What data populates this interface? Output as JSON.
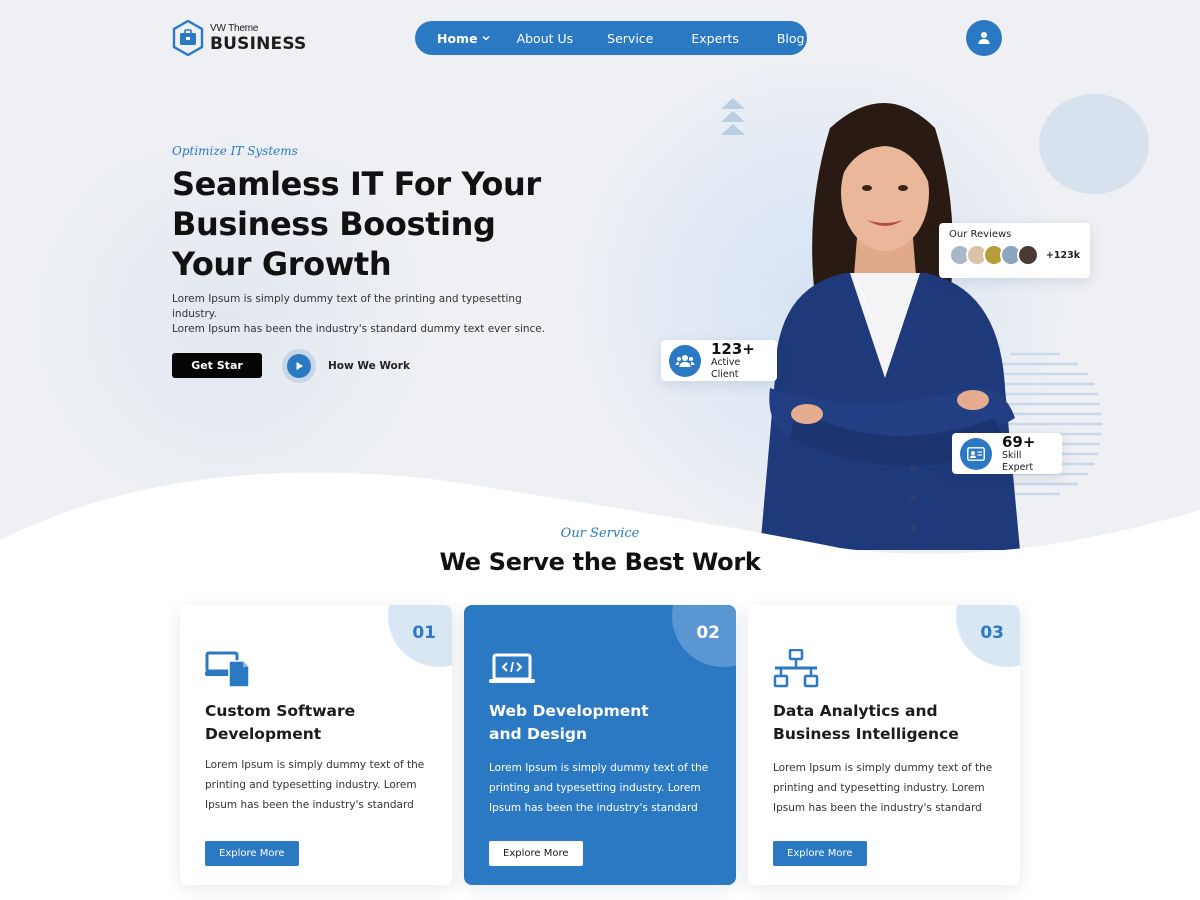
{
  "brand": {
    "small": "VW Theme",
    "big": "BUSINESS"
  },
  "nav": {
    "items": [
      {
        "label": "Home"
      },
      {
        "label": "About Us"
      },
      {
        "label": "Service"
      },
      {
        "label": "Experts"
      },
      {
        "label": "Blog"
      }
    ]
  },
  "hero": {
    "eyebrow": "Optimize IT Systems",
    "title_lines": [
      "Seamless IT For Your",
      "Business Boosting",
      "Your Growth"
    ],
    "desc_lines": [
      "Lorem Ipsum is simply dummy text of the printing and typesetting  industry.",
      "Lorem Ipsum has been the industry's standard dummy text ever since."
    ],
    "primary_button": "Get Star",
    "secondary_button": "How We Work"
  },
  "reviews": {
    "title": "Our Reviews",
    "count": "+123k"
  },
  "stats": {
    "clients": {
      "value": "123+",
      "label": "Active Client"
    },
    "experts": {
      "value": "69+",
      "label": "Skill Expert"
    }
  },
  "services": {
    "eyebrow": "Our Service",
    "title": "We Serve the Best Work",
    "cards": [
      {
        "num": "01",
        "name": "Custom Software Development",
        "desc": "Lorem Ipsum is simply dummy text of the printing and typesetting industry. Lorem Ipsum has been the industry's standard",
        "button": "Explore More",
        "icon": "devices-icon"
      },
      {
        "num": "02",
        "name": "Web Development and Design",
        "desc": "Lorem Ipsum is simply dummy text of the printing and typesetting industry. Lorem Ipsum has been the industry's standard",
        "button": "Explore More",
        "icon": "laptop-code-icon"
      },
      {
        "num": "03",
        "name": "Data Analytics and Business Intelligence",
        "desc": "Lorem Ipsum is simply dummy text of the printing and typesetting industry. Lorem Ipsum has been the industry's standard",
        "button": "Explore More",
        "icon": "network-icon"
      }
    ]
  },
  "colors": {
    "accent": "#2b79c2",
    "hero_bg": "#eef0f3",
    "dark_button": "#050505"
  }
}
